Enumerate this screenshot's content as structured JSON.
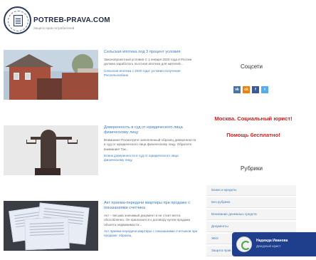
{
  "header": {
    "site_title": "POTREB-PRAVA.COM",
    "tagline": "Защита прав потребителей"
  },
  "posts": [
    {
      "title": "Сельская ипотека под 3 процент условия",
      "excerpt": "Законопроектный условия С 1 января 2020 года в России должна заработать льготная ипотека для жителей...",
      "more": "Сельская ипотека с 2020 года: условия получения Россельхозбанк"
    },
    {
      "title": "Доверенность в суд от юридического лица физическому лицу",
      "excerpt": "Внимание! Посмотрите заполненный образец доверенности в суд от юридического лица физическому лицу. Обратите внимание! Так...",
      "more": "Бланк доверенности в суд от юридического лица физическому лицу"
    },
    {
      "title": "Акт приема-передачи квартиры при продаже с показаниями счетчика",
      "excerpt": "Акт – весьма значимый документ и не стоит вести обособленно. Он прилагается к договору купли-продажи объекта недвижимости...",
      "more": "Акт приема-передачи квартиры с показаниями счетчиков при продаже: образец"
    }
  ],
  "sidebar": {
    "social_title": "Соцсети",
    "social": [
      {
        "icon": "vk-icon",
        "label": "vk",
        "color": "#4c75a3"
      },
      {
        "icon": "odnoklassniki-icon",
        "label": "ok",
        "color": "#ee8208"
      },
      {
        "icon": "facebook-icon",
        "label": "f",
        "color": "#3b5998"
      },
      {
        "icon": "twitter-icon",
        "label": "t",
        "color": "#55acee"
      }
    ],
    "promo_line1": "Москва. Социальный юрист!",
    "promo_line2": "Помощь бесплатно!",
    "rubrics_title": "Рубрики",
    "rubrics": [
      "Банки и кредиты",
      "Без рубрики",
      "Вонзвание денежных средств",
      "Документы",
      "ЖКХ",
      "Защита прав"
    ]
  },
  "chat": {
    "name": "Надежда Иванова",
    "status": "Дежурный юрист"
  },
  "colors": {
    "accent": "#3a7bbf",
    "promo": "#d01e1e",
    "chat_bg": "#1f3f8d"
  }
}
